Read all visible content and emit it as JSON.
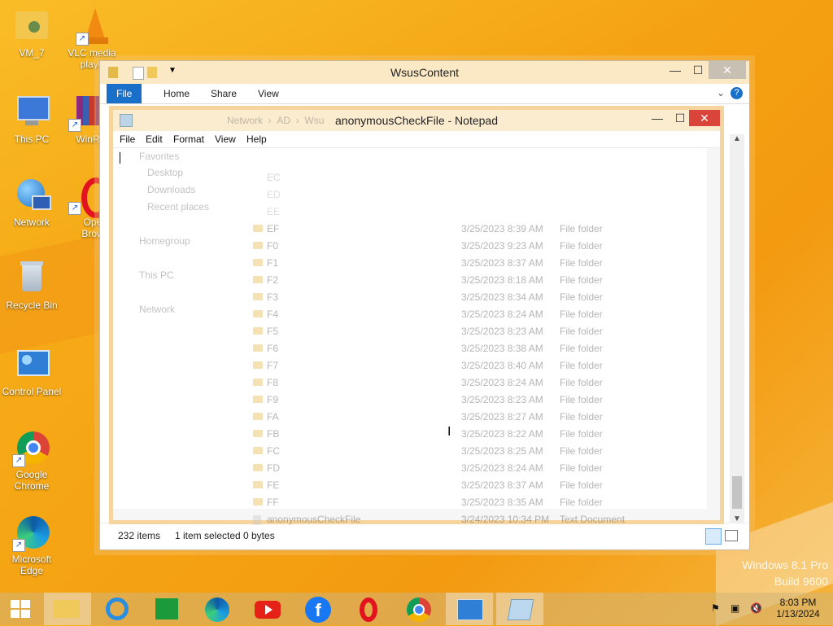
{
  "desktop": {
    "icons": [
      {
        "label": "VM_7"
      },
      {
        "label": "VLC media playe"
      },
      {
        "label": "This PC"
      },
      {
        "label": "WinR"
      },
      {
        "label": "Network"
      },
      {
        "label": "Ope Brow"
      },
      {
        "label": "Recycle Bin"
      },
      {
        "label": "Control Panel"
      },
      {
        "label": "Google Chrome"
      },
      {
        "label": "Microsoft Edge"
      }
    ],
    "watermark": {
      "line1": "Windows 8.1 Pro",
      "line2": "Build 9600"
    }
  },
  "explorer": {
    "title": "WsusContent",
    "ribbon_tabs": [
      "File",
      "Home",
      "Share",
      "View"
    ],
    "breadcrumb": [
      "Network",
      "AD",
      "Wsu"
    ],
    "status": {
      "items": "232 items",
      "selected": "1 item selected",
      "size": "0 bytes"
    },
    "nav": [
      "Favorites",
      "Desktop",
      "Downloads",
      "Recent places",
      "Homegroup",
      "This PC",
      "Network"
    ],
    "rows": [
      {
        "name": "EF",
        "date": "3/25/2023 8:39 AM",
        "type": "File folder"
      },
      {
        "name": "F0",
        "date": "3/25/2023 9:23 AM",
        "type": "File folder"
      },
      {
        "name": "F1",
        "date": "3/25/2023 8:37 AM",
        "type": "File folder"
      },
      {
        "name": "F2",
        "date": "3/25/2023 8:18 AM",
        "type": "File folder"
      },
      {
        "name": "F3",
        "date": "3/25/2023 8:34 AM",
        "type": "File folder"
      },
      {
        "name": "F4",
        "date": "3/25/2023 8:24 AM",
        "type": "File folder"
      },
      {
        "name": "F5",
        "date": "3/25/2023 8:23 AM",
        "type": "File folder"
      },
      {
        "name": "F6",
        "date": "3/25/2023 8:38 AM",
        "type": "File folder"
      },
      {
        "name": "F7",
        "date": "3/25/2023 8:40 AM",
        "type": "File folder"
      },
      {
        "name": "F8",
        "date": "3/25/2023 8:24 AM",
        "type": "File folder"
      },
      {
        "name": "F9",
        "date": "3/25/2023 8:23 AM",
        "type": "File folder"
      },
      {
        "name": "FA",
        "date": "3/25/2023 8:27 AM",
        "type": "File folder"
      },
      {
        "name": "FB",
        "date": "3/25/2023 8:22 AM",
        "type": "File folder"
      },
      {
        "name": "FC",
        "date": "3/25/2023 8:25 AM",
        "type": "File folder"
      },
      {
        "name": "FD",
        "date": "3/25/2023 8:24 AM",
        "type": "File folder"
      },
      {
        "name": "FE",
        "date": "3/25/2023 8:37 AM",
        "type": "File folder"
      },
      {
        "name": "FF",
        "date": "3/25/2023 8:35 AM",
        "type": "File folder"
      },
      {
        "name": "anonymousCheckFile",
        "date": "3/24/2023 10:34 PM",
        "type": "Text Document"
      }
    ],
    "top_rows": [
      "EC",
      "ED",
      "EE"
    ]
  },
  "notepad": {
    "title": "anonymousCheckFile - Notepad",
    "menu": [
      "File",
      "Edit",
      "Format",
      "View",
      "Help"
    ]
  },
  "taskbar": {
    "clock_time": "8:03 PM",
    "clock_date": "1/13/2024"
  }
}
